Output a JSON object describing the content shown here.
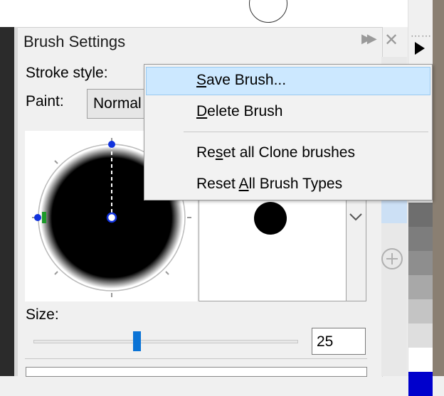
{
  "panel": {
    "title": "Brush Settings",
    "stroke_style_label": "Stroke style:",
    "paint_label": "Paint:",
    "paint_value": "Normal",
    "size_label": "Size:",
    "size_value": "25",
    "size_fraction": 0.39
  },
  "context_menu": {
    "items": [
      {
        "mn": "S",
        "rest": "ave Brush..."
      },
      {
        "mn": "D",
        "rest": "elete Brush"
      },
      {
        "pre": "Re",
        "mn": "s",
        "rest": "et all Clone brushes"
      },
      {
        "pre": "Reset ",
        "mn": "A",
        "rest": "ll Brush Types"
      }
    ]
  },
  "icons": {
    "fast_forward": "fast-forward-icon",
    "close": "close-icon",
    "play": "play-arrow-icon",
    "add": "plus-circle-icon",
    "chevron": "chevron-down-icon"
  },
  "colors": {
    "accent": "#0a73d6",
    "menu_highlight": "#cce8ff",
    "swatches": [
      "#6e6e6e",
      "#7d7d7d",
      "#8e8e8e",
      "#a8a8a8",
      "#c4c4c4",
      "#dedede",
      "#ffffff",
      "#0000cc"
    ]
  }
}
